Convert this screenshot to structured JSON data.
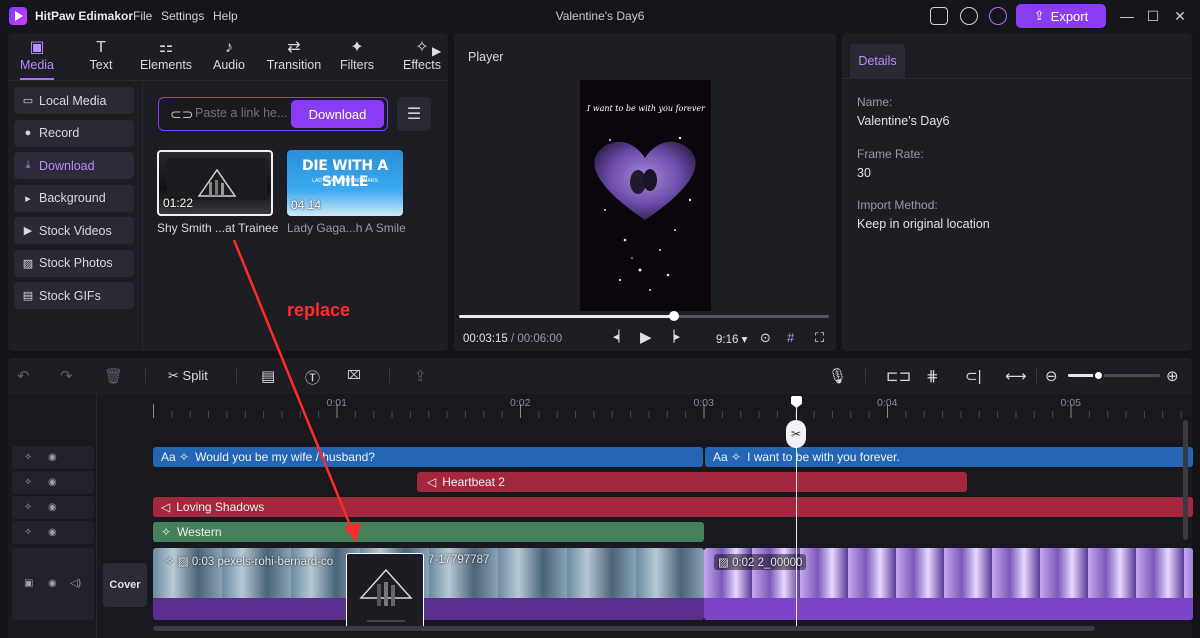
{
  "titlebar": {
    "app_name": "HitPaw Edimakor",
    "menu": [
      "File",
      "Settings",
      "Help"
    ],
    "window_title": "Valentine's Day6",
    "export_label": "Export",
    "icons": [
      "chat-icon",
      "download-icon",
      "user-icon"
    ],
    "win_min": "—",
    "win_max": "☐",
    "win_close": "✕"
  },
  "tabs": [
    {
      "label": "Media",
      "icon": "media-icon",
      "glyph": "▣"
    },
    {
      "label": "Text",
      "icon": "text-icon",
      "glyph": "T"
    },
    {
      "label": "Elements",
      "icon": "elements-icon",
      "glyph": "⚏"
    },
    {
      "label": "Audio",
      "icon": "music-icon",
      "glyph": "♪"
    },
    {
      "label": "Transition",
      "icon": "transition-icon",
      "glyph": "⇄"
    },
    {
      "label": "Filters",
      "icon": "filters-icon",
      "glyph": "✦"
    },
    {
      "label": "Effects",
      "icon": "effects-icon",
      "glyph": "✧"
    }
  ],
  "sidebar": [
    {
      "label": "Local Media",
      "icon": "folder-icon",
      "glyph": "▭"
    },
    {
      "label": "Record",
      "icon": "record-icon",
      "glyph": "●"
    },
    {
      "label": "Download",
      "icon": "download-icon",
      "glyph": "⤓"
    },
    {
      "label": "Background",
      "icon": "play-small-icon",
      "glyph": "▸"
    },
    {
      "label": "Stock Videos",
      "icon": "video-icon",
      "glyph": "▶"
    },
    {
      "label": "Stock Photos",
      "icon": "photo-icon",
      "glyph": "▨"
    },
    {
      "label": "Stock GIFs",
      "icon": "gif-icon",
      "glyph": "▤"
    }
  ],
  "download_panel": {
    "placeholder": "Paste a link he...",
    "button_label": "Download"
  },
  "media": [
    {
      "title": "Shy Smith ...at Trainee",
      "duration": "01:22",
      "selected": true
    },
    {
      "title": "Lady Gaga...h A Smile",
      "duration": "04:14",
      "selected": false,
      "cover_text": "DIE WITH A SMILE",
      "cover_sub": "LADY GAGA, BRUNO MARS"
    }
  ],
  "player": {
    "label": "Player",
    "caption": "I want to be with you forever",
    "current_time": "00:03:15",
    "total_time": "/ 00:06:00",
    "progress": 0.58,
    "aspect": "9:16"
  },
  "details": {
    "tab": "Details",
    "fields": [
      {
        "key": "Name:",
        "value": "Valentine's Day6"
      },
      {
        "key": "Frame Rate:",
        "value": "30"
      },
      {
        "key": "Import Method:",
        "value": "Keep in original location"
      }
    ]
  },
  "toolbar": {
    "split_label": "Split",
    "zoom_level": 0.33
  },
  "ruler": {
    "ticks": [
      "0:01",
      "0:02",
      "0:03",
      "0:04",
      "0:05"
    ]
  },
  "tracks": {
    "text_clip_1": "Would you be my wife / husband?",
    "text_clip_2": "I want to be with you forever.",
    "audio_clip": "Heartbeat 2",
    "music_clip": "Loving Shadows",
    "effect_clip": "Western",
    "video_clip_1": "0:03  pexels-rohi-bernard-co",
    "video_clip_1_tail": "7-17797787",
    "video_clip_2": "0:02  2_00000",
    "cover_label": "Cover"
  },
  "annotation": {
    "label": "replace",
    "color": "#ff2b2b"
  },
  "colors": {
    "accent": "#8a3cf2",
    "text_track": "#2466b4",
    "audio_track": "#a3283e",
    "effect_track": "#458259"
  }
}
